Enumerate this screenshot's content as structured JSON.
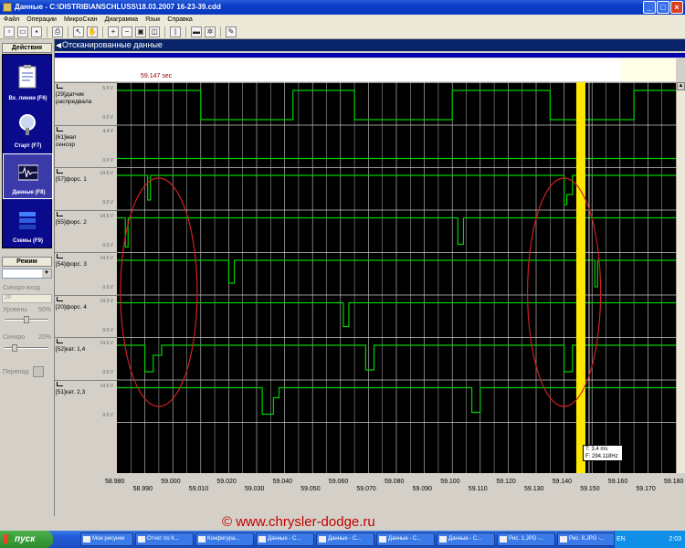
{
  "window": {
    "title": "Данные - C:\\DISTRIB\\ANSCHLUSS\\18.03.2007 16-23-39.cdd"
  },
  "menu": [
    "Файл",
    "Операции",
    "МикроСкан",
    "Диаграмма",
    "Язык",
    "Справка"
  ],
  "left_panel": {
    "actions_title": "Действия",
    "actions": [
      {
        "label": "Вх. линии (F6)",
        "icon": "clipboard-icon",
        "selected": false
      },
      {
        "label": "Старт (F7)",
        "icon": "magnifier-icon",
        "selected": false
      },
      {
        "label": "Данные (F8)",
        "icon": "waveform-icon",
        "selected": true
      },
      {
        "label": "Схемы (F9)",
        "icon": "stack-icon",
        "selected": false
      }
    ],
    "mode_title": "Режим",
    "sync_input_label": "Синхро вход",
    "sync_input_value": "29",
    "level_label": "Уровень",
    "level_value": "50%",
    "level_fraction": 0.5,
    "sync_label": "Синхро",
    "sync_value": "20%",
    "sync_fraction": 0.2,
    "perepad_label": "Перепад"
  },
  "main": {
    "header": "Отсканированные данные",
    "time_marker": "59.147 sec",
    "channels": [
      {
        "name": "[29]датчик распредвала",
        "vmax": "5.5 V",
        "vmin": "0.0 V"
      },
      {
        "name": "[61]мап сенсор",
        "vmax": "4.4 V",
        "vmin": "0.0 V"
      },
      {
        "name": "[57]форс. 1",
        "vmax": "14.6 V",
        "vmin": "0.0 V"
      },
      {
        "name": "[55]форс. 2",
        "vmax": "14.5 V",
        "vmin": "0.0 V"
      },
      {
        "name": "[54]форс. 3",
        "vmax": "14.5 V",
        "vmin": "0.0 V"
      },
      {
        "name": "[20]форс. 4",
        "vmax": "14.3 V",
        "vmin": "0.0 V"
      },
      {
        "name": "[52]кат. 1,4",
        "vmax": "14.6 V",
        "vmin": "0.0 V"
      },
      {
        "name": "[51]кат. 2,3",
        "vmax": "14.5 V",
        "vmin": "0.0 V"
      }
    ],
    "cursor_info": {
      "t": "T: 3,4 ms",
      "f": "F: 294.118Hz"
    },
    "x_ticks_upper": [
      "59.000",
      "59.020",
      "59.040",
      "59.060",
      "59.080",
      "59.100",
      "59.120",
      "59.140",
      "59.160",
      "59.180"
    ],
    "x_ticks_lower": [
      "58.990",
      "59.010",
      "59.030",
      "59.050",
      "59.070",
      "59.090",
      "59.110",
      "59.130",
      "59.150",
      "59.170"
    ],
    "x_tick_first": "58.980"
  },
  "watermark": "© www.chrysler-dodge.ru",
  "taskbar": {
    "start_label": "пуск",
    "tasks": [
      "Мои рисунки",
      "Отчет по К...",
      "Конфигура...",
      "Данные - С...",
      "Данные - С...",
      "Данные - С...",
      "Данные - С...",
      "Рис. 1.JPG -...",
      "Рис. 8.JPG -..."
    ],
    "lang": "EN",
    "clock": "2:03"
  },
  "colors": {
    "trace": "#00d000",
    "cursor": "#ffe800",
    "annotation": "#d02020",
    "titlebar": "#0a3cc8"
  }
}
